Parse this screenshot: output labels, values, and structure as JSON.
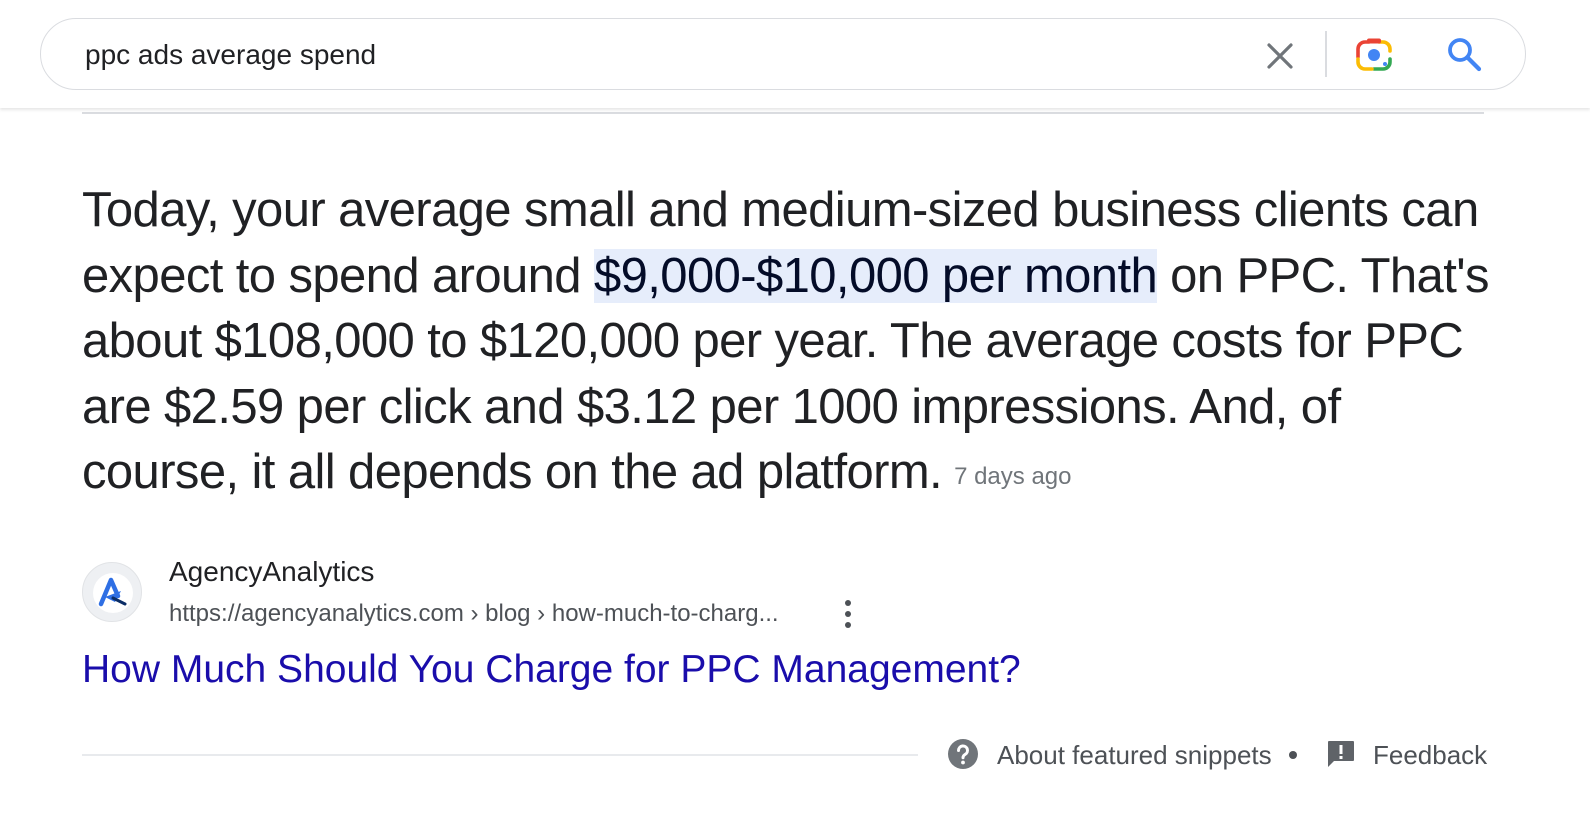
{
  "search": {
    "query": "ppc ads average spend",
    "clear_icon": "close-icon",
    "camera_icon": "google-lens-icon",
    "search_icon": "search-icon"
  },
  "snippet": {
    "text_before": "Today, your average small and medium-sized business clients can expect to spend around ",
    "highlight": "$9,000-$10,000 per month",
    "text_after": " on PPC. That's about $108,000 to $120,000 per year. The average costs for PPC are $2.59 per click and $3.12 per 1000 impressions. And, of course, it all depends on the ad platform.",
    "date": "7 days ago"
  },
  "source": {
    "name": "AgencyAnalytics",
    "url": "https://agencyanalytics.com › blog › how-much-to-charg...",
    "favicon": "agencyanalytics-logo",
    "more_icon": "more-vert-icon"
  },
  "result": {
    "title": "How Much Should You Charge for PPC Management?"
  },
  "footer": {
    "about_label": "About featured snippets",
    "feedback_label": "Feedback",
    "help_icon": "help-circle-icon",
    "feedback_icon": "feedback-icon"
  },
  "colors": {
    "link": "#1a0dab",
    "highlight_bg": "#e6edfb",
    "text": "#202124",
    "secondary_text": "#4d5156"
  }
}
